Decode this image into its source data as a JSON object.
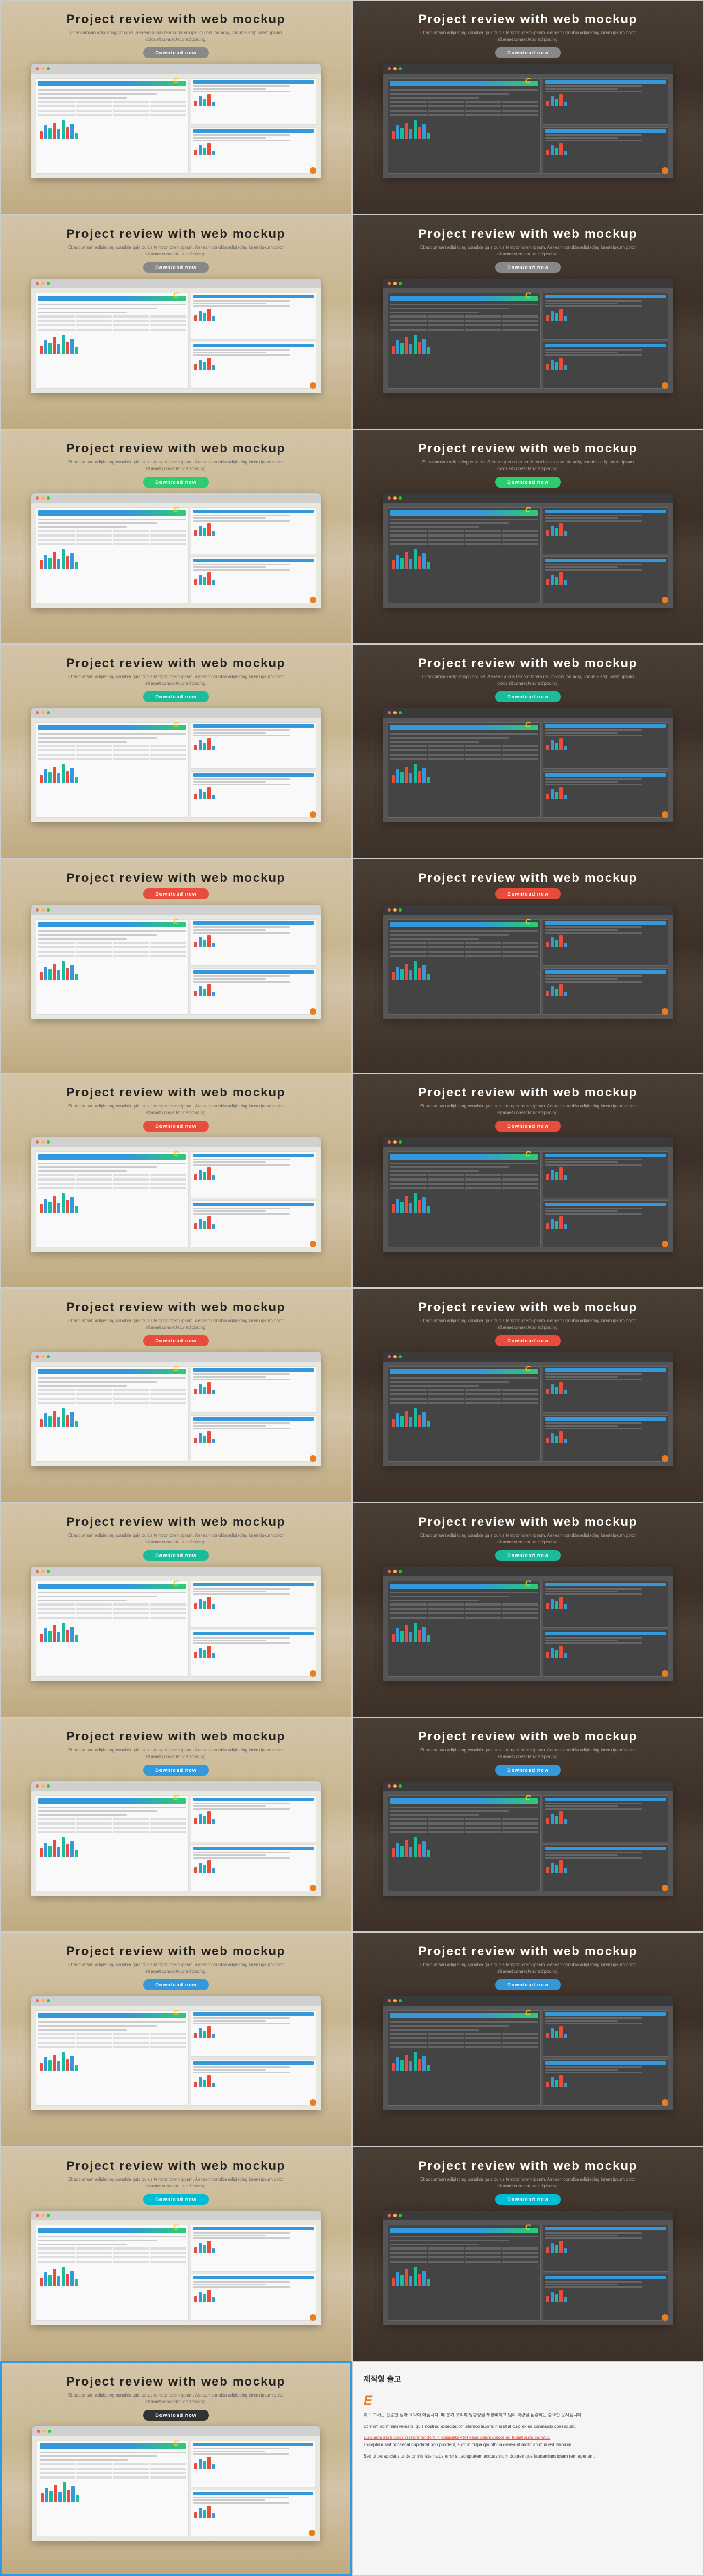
{
  "title": "Project review with web mockup",
  "cards": [
    {
      "theme": "light",
      "btnClass": "btn-gray",
      "btnLabel": "Download now",
      "subtitle": "Et accumsan adipiscing conubia. Aenean purus tempor lorem ipsum conubia adip, conubia adip lorem ipsum dolor sit consectetur adipiscing."
    },
    {
      "theme": "dark",
      "btnClass": "btn-gray",
      "btnLabel": "Download now",
      "subtitle": "Et accumsan adipiscing conubia quis purus tempor lorem ipsum. Aenean conubia adipiscing lorem ipsum dolor sit amet consectetur adipiscing."
    },
    {
      "theme": "light",
      "btnClass": "btn-gray",
      "btnLabel": "Download now",
      "subtitle": "Et accumsan adipiscing conubia quis purus tempor lorem ipsum. Aenean conubia adipiscing lorem ipsum dolor sit amet consectetur adipiscing."
    },
    {
      "theme": "dark",
      "btnClass": "btn-gray",
      "btnLabel": "Download now",
      "subtitle": "Et accumsan adipiscing conubia quis purus tempor lorem ipsum. Aenean conubia adipiscing lorem ipsum dolor sit amet consectetur adipiscing."
    },
    {
      "theme": "light",
      "btnClass": "btn-green",
      "btnLabel": "Download now",
      "subtitle": "Et accumsan adipiscing conubia quis purus tempor lorem ipsum. Aenean conubia adipiscing lorem ipsum dolor sit amet consectetur adipiscing."
    },
    {
      "theme": "dark",
      "btnClass": "btn-green",
      "btnLabel": "Download now",
      "subtitle": "Et accumsan adipiscing conubia. Aenean purus tempor lorem ipsum conubia adip, conubia adip lorem ipsum dolor sit consectetur adipiscing."
    },
    {
      "theme": "light",
      "btnClass": "btn-teal",
      "btnLabel": "Download now",
      "subtitle": "Et accumsan adipiscing conubia quis purus tempor lorem ipsum. Aenean conubia adipiscing lorem ipsum dolor sit amet consectetur adipiscing."
    },
    {
      "theme": "dark",
      "btnClass": "btn-teal",
      "btnLabel": "Download now",
      "subtitle": "Et accumsan adipiscing conubia. Aenean purus tempor lorem ipsum conubia adip, conubia adip lorem ipsum dolor sit consectetur adipiscing."
    },
    {
      "theme": "light",
      "btnClass": "btn-red",
      "btnLabel": "Download now",
      "subtitle": ""
    },
    {
      "theme": "dark",
      "btnClass": "btn-red",
      "btnLabel": "Download now",
      "subtitle": ""
    },
    {
      "theme": "light",
      "btnClass": "btn-red",
      "btnLabel": "Download now",
      "subtitle": "Et accumsan adipiscing conubia quis purus tempor lorem ipsum. Aenean conubia adipiscing lorem ipsum dolor sit amet consectetur adipiscing."
    },
    {
      "theme": "dark",
      "btnClass": "btn-red",
      "btnLabel": "Download now",
      "subtitle": "Et accumsan adipiscing conubia quis purus tempor lorem ipsum. Aenean conubia adipiscing lorem ipsum dolor sit amet consectetur adipiscing."
    },
    {
      "theme": "light",
      "btnClass": "btn-red",
      "btnLabel": "Download now",
      "subtitle": "Et accumsan adipiscing conubia quis purus tempor lorem ipsum. Aenean conubia adipiscing lorem ipsum dolor sit amet consectetur adipiscing."
    },
    {
      "theme": "dark",
      "btnClass": "btn-red",
      "btnLabel": "Download now",
      "subtitle": "Et accumsan adipiscing conubia quis purus tempor lorem ipsum. Aenean conubia adipiscing lorem ipsum dolor sit amet consectetur adipiscing."
    },
    {
      "theme": "light",
      "btnClass": "btn-teal",
      "btnLabel": "Download now",
      "subtitle": "Et accumsan adipiscing conubia quis purus tempor lorem ipsum. Aenean conubia adipiscing lorem ipsum dolor sit amet consectetur adipiscing."
    },
    {
      "theme": "dark",
      "btnClass": "btn-teal",
      "btnLabel": "Download now",
      "subtitle": "Et accumsan adipiscing conubia quis purus tempor lorem ipsum. Aenean conubia adipiscing lorem ipsum dolor sit amet consectetur adipiscing."
    },
    {
      "theme": "light",
      "btnClass": "btn-blue",
      "btnLabel": "Download now",
      "subtitle": "Et accumsan adipiscing conubia quis purus tempor lorem ipsum. Aenean conubia adipiscing lorem ipsum dolor sit amet consectetur adipiscing."
    },
    {
      "theme": "dark",
      "btnClass": "btn-blue",
      "btnLabel": "Download now",
      "subtitle": "Et accumsan adipiscing conubia quis purus tempor lorem ipsum. Aenean conubia adipiscing lorem ipsum dolor sit amet consectetur adipiscing."
    },
    {
      "theme": "light",
      "btnClass": "btn-blue",
      "btnLabel": "Download now",
      "subtitle": "Et accumsan adipiscing conubia quis purus tempor lorem ipsum. Aenean conubia adipiscing lorem ipsum dolor sit amet consectetur adipiscing."
    },
    {
      "theme": "dark",
      "btnClass": "btn-blue",
      "btnLabel": "Download now",
      "subtitle": "Et accumsan adipiscing conubia quis purus tempor lorem ipsum. Aenean conubia adipiscing lorem ipsum dolor sit amet consectetur adipiscing."
    },
    {
      "theme": "light",
      "btnClass": "btn-cyan",
      "btnLabel": "Download now",
      "subtitle": "Et accumsan adipiscing conubia quis purus tempor lorem ipsum. Aenean conubia adipiscing lorem ipsum dolor sit amet consectetur adipiscing."
    },
    {
      "theme": "dark",
      "btnClass": "btn-cyan",
      "btnLabel": "Download now",
      "subtitle": "Et accumsan adipiscing conubia quis purus tempor lorem ipsum. Aenean conubia adipiscing lorem ipsum dolor sit amet consectetur adipiscing."
    },
    {
      "theme": "light",
      "btnClass": "btn-dark",
      "btnLabel": "Download now",
      "subtitle": "Et accumsan adipiscing conubia quis purus tempor lorem ipsum. Aenean conubia adipiscing lorem ipsum dolor sit amet consectetur adipiscing.",
      "highlight": true
    },
    {
      "theme": "special",
      "btnClass": "",
      "btnLabel": "",
      "subtitle": ""
    }
  ],
  "lastCard": {
    "title": "제작형 출고",
    "body1": "이 보고서는 단순한 성과 요약이 아닙니다. 매 분기 우리의 방향성을 재정비하고 팀의 역량을 점검하는 중요한 문서입니다.",
    "body2": "Ut enim ad minim veniam, quis nostrud exercitation ullamco laboris nisi ut aliquip ex ea commodo consequat.",
    "link": "Duis aute irure dolor in reprehenderit in voluptate velit esse cillum dolore eu fugiat nulla pariatur.",
    "body3": "Excepteur sint occaecat cupidatat non proident, sunt in culpa qui officia deserunt mollit anim id est laborum.",
    "body4": "Sed ut perspiciatis unde omnis iste natus error sit voluptatem accusantium doloremque laudantium totam rem aperiam."
  }
}
